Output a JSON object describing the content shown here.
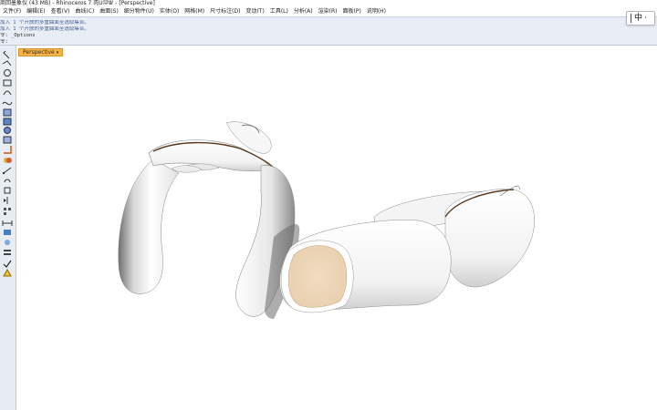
{
  "window": {
    "title": "商回墨象仪 (43 MB) - Rhinoceros 7 肉Ǔ泤Ꮤ - [Perspective]"
  },
  "menu": {
    "items": [
      "文件(F)",
      "编辑(E)",
      "查看(V)",
      "曲线(C)",
      "曲面(S)",
      "细分物件(U)",
      "实体(O)",
      "网格(M)",
      "尺寸标注(D)",
      "变动(T)",
      "工具(L)",
      "分析(A)",
      "渲染(R)",
      "面板(P)",
      "说明(H)"
    ]
  },
  "command": {
    "history": [
      "加入 1 个开放的多重曲面至选取集合。",
      "加入 1 个开放的多重曲面至选取集合。"
    ],
    "last_command": "令: _Options",
    "prompt": "令:"
  },
  "ime": {
    "label": "中",
    "extra": "·"
  },
  "viewport": {
    "tab_label": "Perspective",
    "tab_arrow": "▾"
  }
}
